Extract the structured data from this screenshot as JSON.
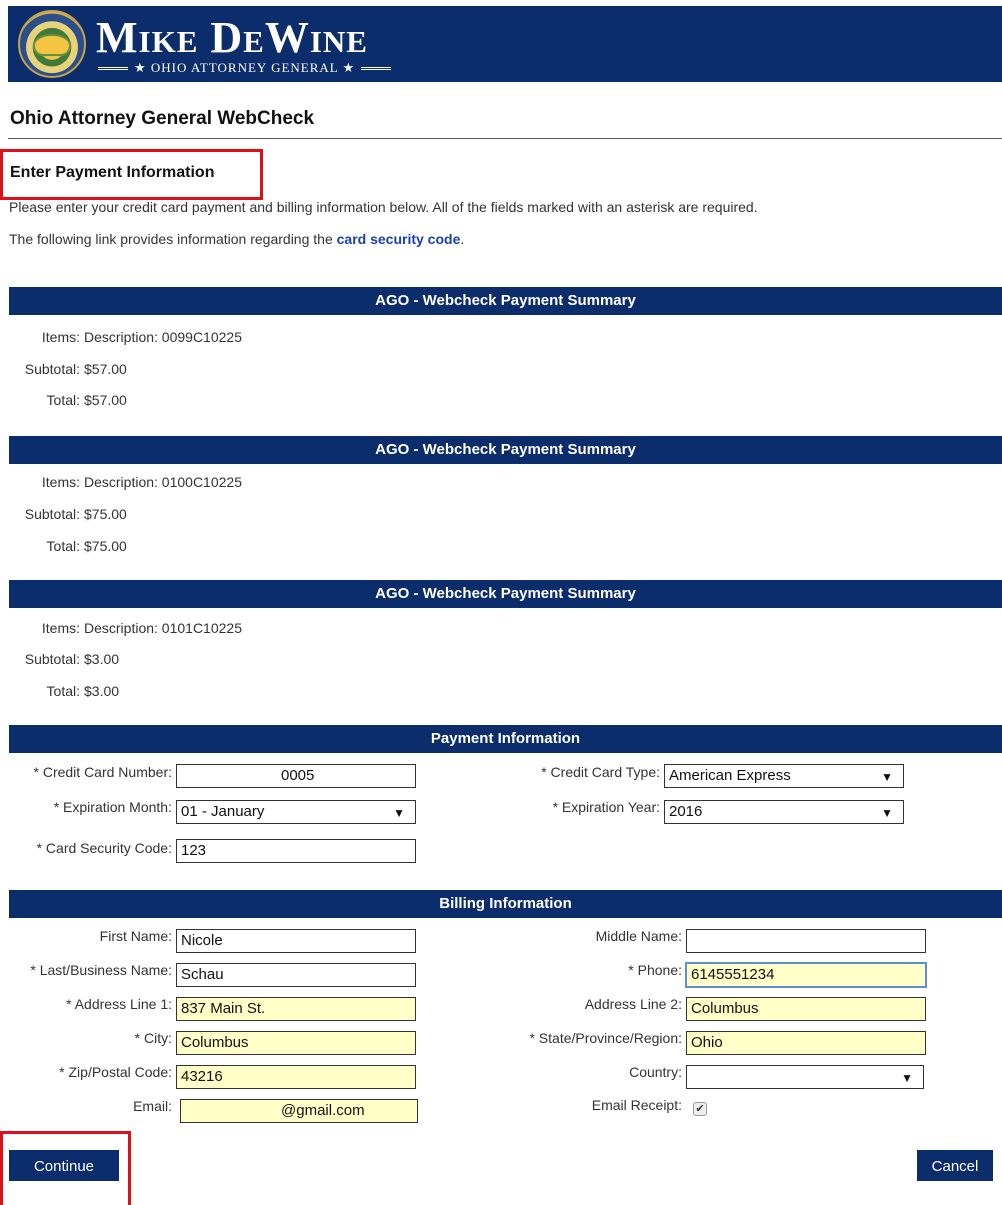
{
  "header": {
    "brand_name": "Mike DeWine",
    "brand_subtitle": "★ OHIO ATTORNEY GENERAL ★",
    "app_title": "Ohio Attorney General WebCheck"
  },
  "page": {
    "section_title": "Enter Payment Information",
    "intro": "Please enter your credit card payment and billing information below. All of the fields marked with an asterisk are required.",
    "link_prefix": "The following link provides information regarding the ",
    "link_text": "card security code",
    "link_suffix": "."
  },
  "summaries": [
    {
      "bar_title": "AGO - Webcheck Payment Summary",
      "items_label": "Items:",
      "items_value": "Description: 0099C10225",
      "subtotal_label": "Subtotal:",
      "subtotal_value": "$57.00",
      "total_label": "Total:",
      "total_value": "$57.00"
    },
    {
      "bar_title": "AGO - Webcheck Payment Summary",
      "items_label": "Items:",
      "items_value": "Description: 0100C10225",
      "subtotal_label": "Subtotal:",
      "subtotal_value": "$75.00",
      "total_label": "Total:",
      "total_value": "$75.00"
    },
    {
      "bar_title": "AGO - Webcheck Payment Summary",
      "items_label": "Items:",
      "items_value": "Description: 0101C10225",
      "subtotal_label": "Subtotal:",
      "subtotal_value": "$3.00",
      "total_label": "Total:",
      "total_value": "$3.00"
    }
  ],
  "payment": {
    "bar_title": "Payment Information",
    "card_number_label": "* Credit Card Number:",
    "card_number_value": "0005",
    "card_type_label": "* Credit Card Type:",
    "card_type_value": "American Express",
    "exp_month_label": "* Expiration Month:",
    "exp_month_value": "01 - January",
    "exp_year_label": "* Expiration Year:",
    "exp_year_value": "2016",
    "csc_label": "* Card Security Code:",
    "csc_value": "123"
  },
  "billing": {
    "bar_title": "Billing Information",
    "first_name_label": "First Name:",
    "first_name_value": "Nicole",
    "middle_name_label": "Middle Name:",
    "middle_name_value": "",
    "last_name_label": "* Last/Business Name:",
    "last_name_value": "Schau",
    "phone_label": "* Phone:",
    "phone_value": "6145551234",
    "address1_label": "* Address Line 1:",
    "address1_value": "837 Main St.",
    "address2_label": "Address Line 2:",
    "address2_value": "Columbus",
    "city_label": "* City:",
    "city_value": "Columbus",
    "state_label": "* State/Province/Region:",
    "state_value": "Ohio",
    "zip_label": "* Zip/Postal Code:",
    "zip_value": "43216",
    "country_label": "Country:",
    "country_value": "",
    "email_label": "Email:",
    "email_value": "@gmail.com",
    "email_receipt_label": "Email Receipt:",
    "email_receipt_checked": true
  },
  "buttons": {
    "continue_label": "Continue",
    "cancel_label": "Cancel"
  },
  "icons": {
    "dropdown_arrow": "▼",
    "checkmark": "✔"
  },
  "colors": {
    "brand_navy": "#0c2d6b",
    "annotation_red": "#e0101a",
    "autofill_yellow": "#ffffc8",
    "link_blue": "#1a3fb0"
  }
}
